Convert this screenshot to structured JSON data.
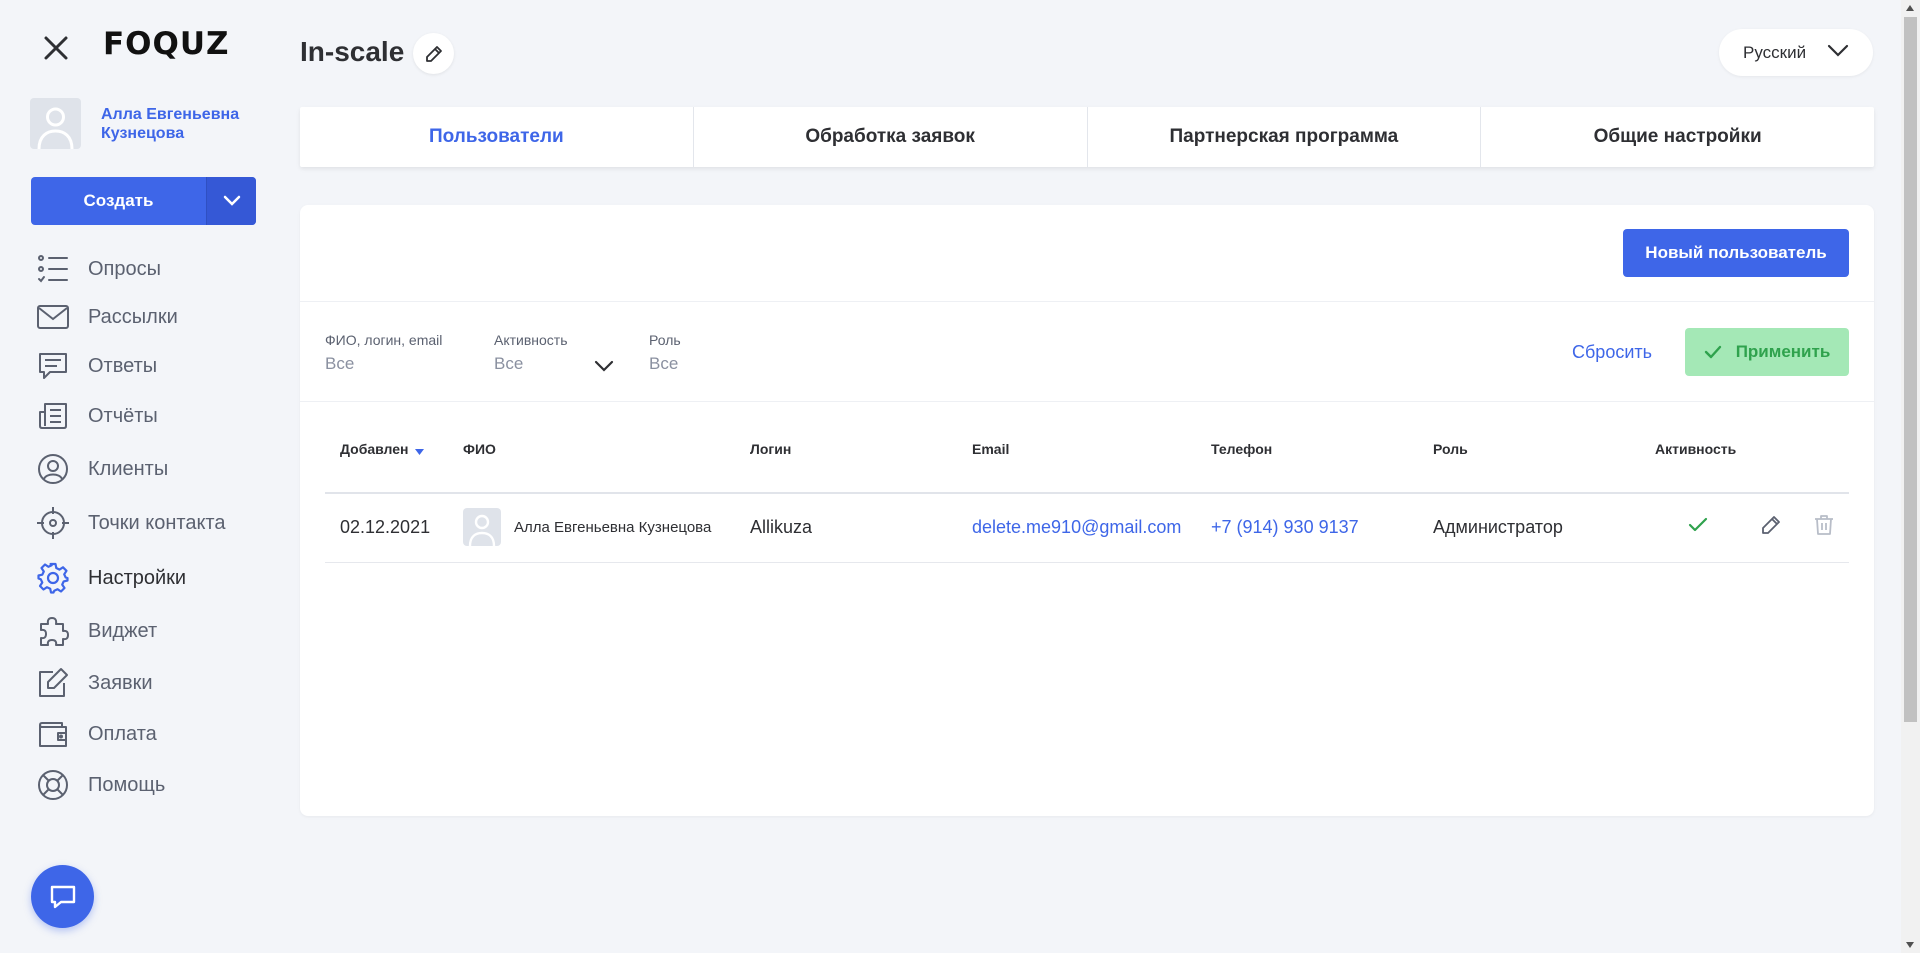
{
  "brand": {
    "logo": "FOQUZ"
  },
  "user": {
    "name": "Алла Евгеньевна Кузнецова"
  },
  "create": {
    "label": "Создать"
  },
  "nav": [
    {
      "label": "Опросы",
      "icon": "list-check-icon"
    },
    {
      "label": "Рассылки",
      "icon": "envelope-icon"
    },
    {
      "label": "Ответы",
      "icon": "message-icon"
    },
    {
      "label": "Отчёты",
      "icon": "report-icon"
    },
    {
      "label": "Клиенты",
      "icon": "user-circle-icon"
    },
    {
      "label": "Точки контакта",
      "icon": "target-icon"
    },
    {
      "label": "Настройки",
      "icon": "gear-icon",
      "active": true
    },
    {
      "label": "Виджет",
      "icon": "puzzle-icon"
    },
    {
      "label": "Заявки",
      "icon": "edit-square-icon"
    },
    {
      "label": "Оплата",
      "icon": "wallet-icon"
    },
    {
      "label": "Помощь",
      "icon": "lifebuoy-icon"
    }
  ],
  "header": {
    "title": "In-scale",
    "language": "Русский"
  },
  "tabs": [
    {
      "label": "Пользователи",
      "active": true
    },
    {
      "label": "Обработка заявок"
    },
    {
      "label": "Партнерская программа"
    },
    {
      "label": "Общие настройки"
    }
  ],
  "actions": {
    "new_user": "Новый пользователь",
    "reset": "Сбросить",
    "apply": "Применить"
  },
  "filters": {
    "search": {
      "label": "ФИО, логин, email",
      "value": "Все"
    },
    "activity": {
      "label": "Активность",
      "value": "Все"
    },
    "role": {
      "label": "Роль",
      "value": "Все"
    }
  },
  "table": {
    "columns": [
      "Добавлен",
      "ФИО",
      "Логин",
      "Email",
      "Телефон",
      "Роль",
      "Активность"
    ],
    "rows": [
      {
        "added": "02.12.2021",
        "name": "Алла Евгеньевна Кузнецова",
        "login": "Allikuza",
        "email": "delete.me910@gmail.com",
        "phone": "+7 (914) 930 9137",
        "role": "Администратор",
        "active": true
      }
    ]
  },
  "colors": {
    "accent": "#3e66e8",
    "success": "#2fa24d",
    "success_bg": "#a4e8b6"
  }
}
